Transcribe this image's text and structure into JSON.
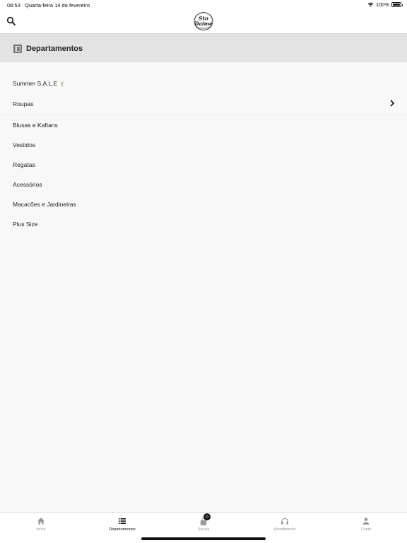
{
  "status_bar": {
    "time": "08:53",
    "date": "Quarta-feira 14 de fevereiro",
    "battery": "100%"
  },
  "header": {
    "logo_text": "Sto Daime",
    "search_icon": "search-icon"
  },
  "section": {
    "title": "Departamentos",
    "icon": "list-document-icon"
  },
  "departments": [
    {
      "label": "Summer S.A.L.E",
      "icon": "palm-tree-icon"
    },
    {
      "label": "Roupas",
      "icon": "chevron-right-icon"
    },
    {
      "label": "Blusas e Kaftans"
    },
    {
      "label": "Vestidos"
    },
    {
      "label": "Regatas"
    },
    {
      "label": "Acessórios"
    },
    {
      "label": "Macacões e Jardineiras"
    },
    {
      "label": "Plus Size"
    }
  ],
  "tab_bar": {
    "tabs": [
      {
        "label": "Início",
        "icon": "home-icon",
        "active": false
      },
      {
        "label": "Departamentos",
        "icon": "list-icon",
        "active": true
      },
      {
        "label": "Sacola",
        "icon": "bag-icon",
        "active": false,
        "badge": "0"
      },
      {
        "label": "Atendimento",
        "icon": "headphones-icon",
        "active": false
      },
      {
        "label": "Conta",
        "icon": "user-icon",
        "active": false
      }
    ]
  },
  "colors": {
    "active_tab": "#111111",
    "inactive_tab": "#9a9a9a",
    "section_bg": "#e3e3e3",
    "page_bg": "#f8f8f8",
    "palm_green": "#6ca83c"
  }
}
